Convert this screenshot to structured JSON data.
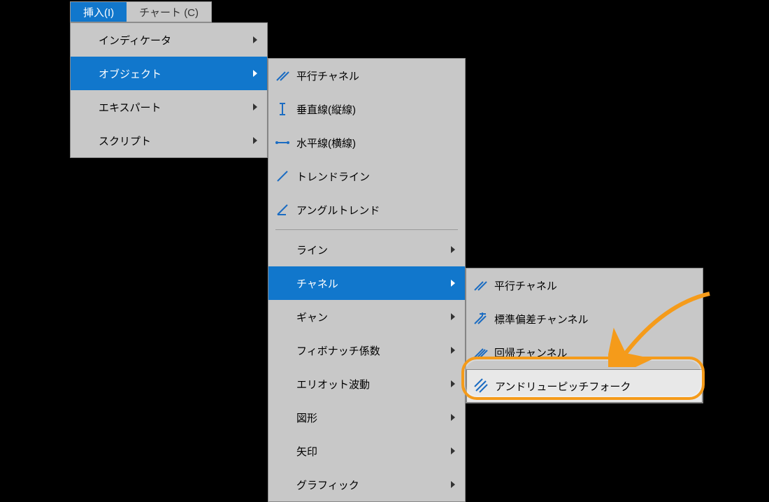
{
  "menubar": {
    "insert": "挿入(I)",
    "chart": "チャート (C)"
  },
  "menu1": {
    "indicators": "インディケータ",
    "objects": "オブジェクト",
    "experts": "エキスパート",
    "scripts": "スクリプト"
  },
  "menu2": {
    "parallel_channel": "平行チャネル",
    "vertical_line": "垂直線(縦線)",
    "horizontal_line": "水平線(横線)",
    "trendline": "トレンドライン",
    "angle_trend": "アングルトレンド",
    "line": "ライン",
    "channel": "チャネル",
    "gann": "ギャン",
    "fibonacci": "フィボナッチ係数",
    "elliott": "エリオット波動",
    "shapes": "図形",
    "arrows": "矢印",
    "graphic": "グラフィック"
  },
  "menu3": {
    "parallel_channel": "平行チャネル",
    "stddev_channel": "標準偏差チャンネル",
    "regression_channel": "回帰チャンネル",
    "andrews_pitchfork": "アンドリューピッチフォーク"
  }
}
